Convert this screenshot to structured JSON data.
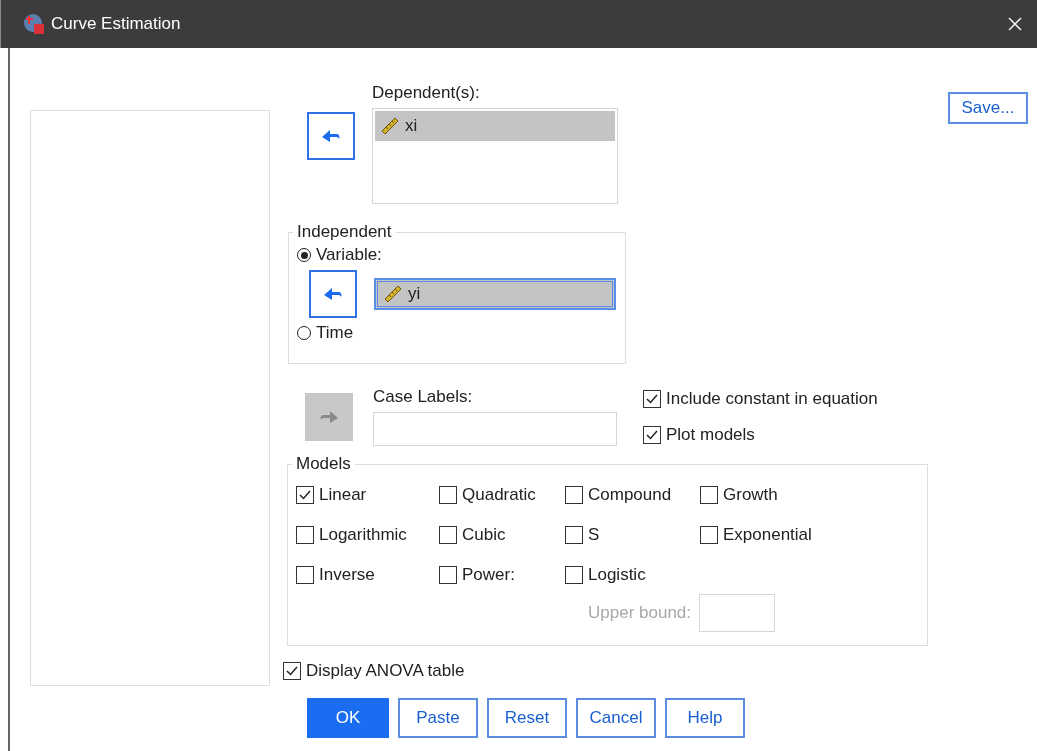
{
  "window": {
    "title": "Curve Estimation"
  },
  "save_button": {
    "label": "Save..."
  },
  "dependents": {
    "label": "Dependent(s):",
    "items": [
      {
        "name": "xi",
        "selected": true
      }
    ]
  },
  "independent": {
    "legend": "Independent",
    "options": [
      {
        "label": "Variable:",
        "selected": true
      },
      {
        "label": "Time",
        "selected": false
      }
    ],
    "variable": {
      "name": "yi",
      "selected": true
    }
  },
  "case_labels": {
    "label": "Case Labels:",
    "arrow_disabled": true
  },
  "options": [
    {
      "label": "Include constant in equation",
      "checked": true
    },
    {
      "label": "Plot models",
      "checked": true
    }
  ],
  "models": {
    "legend": "Models",
    "items": [
      {
        "label": "Linear",
        "checked": true
      },
      {
        "label": "Quadratic",
        "checked": false
      },
      {
        "label": "Compound",
        "checked": false
      },
      {
        "label": "Growth",
        "checked": false
      },
      {
        "label": "Logarithmic",
        "checked": false
      },
      {
        "label": "Cubic",
        "checked": false
      },
      {
        "label": "S",
        "checked": false
      },
      {
        "label": "Exponential",
        "checked": false
      },
      {
        "label": "Inverse",
        "checked": false
      },
      {
        "label": "Power:",
        "checked": false
      },
      {
        "label": "Logistic",
        "checked": false
      }
    ],
    "upper_bound": {
      "label": "Upper bound:",
      "disabled": true
    }
  },
  "display_anova": {
    "label": "Display ANOVA table",
    "checked": true
  },
  "buttons": [
    {
      "label": "OK",
      "kind": "default"
    },
    {
      "label": "Paste",
      "kind": "normal"
    },
    {
      "label": "Reset",
      "kind": "normal"
    },
    {
      "label": "Cancel",
      "kind": "normal"
    },
    {
      "label": "Help",
      "kind": "normal"
    }
  ]
}
